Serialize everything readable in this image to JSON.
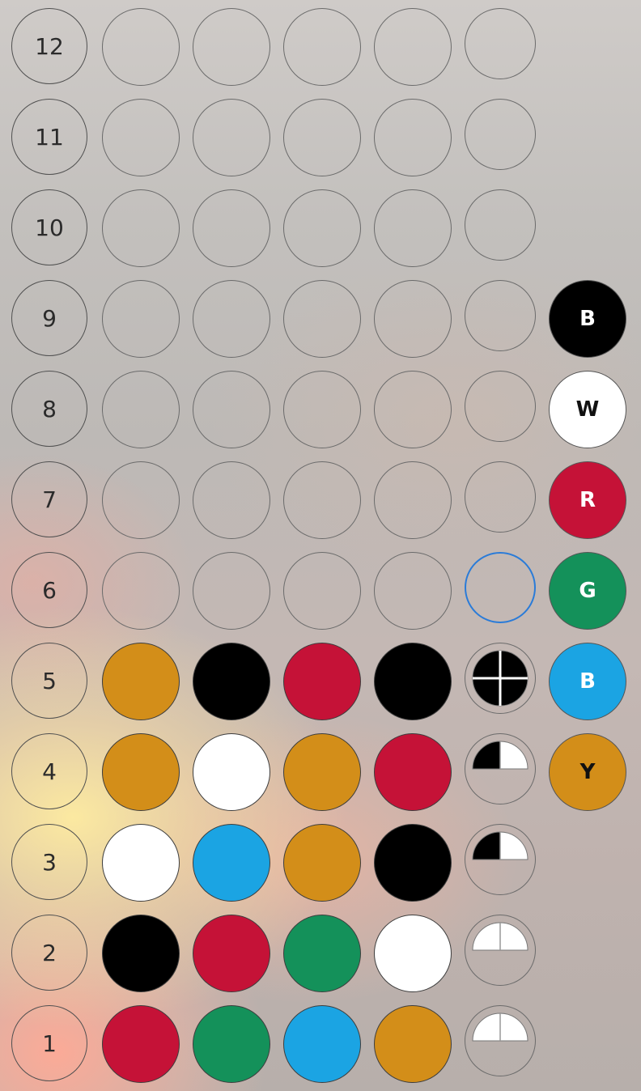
{
  "colors": {
    "orange": "#d38e19",
    "black": "#000000",
    "red": "#c51237",
    "white": "#ffffff",
    "blue": "#1ba4e3",
    "green": "#14915a"
  },
  "rows": [
    {
      "label": "12",
      "pegs": [
        null,
        null,
        null,
        null
      ],
      "feedback": null
    },
    {
      "label": "11",
      "pegs": [
        null,
        null,
        null,
        null
      ],
      "feedback": null
    },
    {
      "label": "10",
      "pegs": [
        null,
        null,
        null,
        null
      ],
      "feedback": null
    },
    {
      "label": "9",
      "pegs": [
        null,
        null,
        null,
        null
      ],
      "feedback": null
    },
    {
      "label": "8",
      "pegs": [
        null,
        null,
        null,
        null
      ],
      "feedback": null
    },
    {
      "label": "7",
      "pegs": [
        null,
        null,
        null,
        null
      ],
      "feedback": null
    },
    {
      "label": "6",
      "pegs": [
        null,
        null,
        null,
        null
      ],
      "feedback": null,
      "active": true
    },
    {
      "label": "5",
      "pegs": [
        "orange",
        "black",
        "red",
        "black"
      ],
      "feedback": [
        "black",
        "black",
        "black",
        "black"
      ]
    },
    {
      "label": "4",
      "pegs": [
        "orange",
        "white",
        "orange",
        "red"
      ],
      "feedback": [
        "black",
        "white"
      ]
    },
    {
      "label": "3",
      "pegs": [
        "white",
        "blue",
        "orange",
        "black"
      ],
      "feedback": [
        "black",
        "white"
      ]
    },
    {
      "label": "2",
      "pegs": [
        "black",
        "red",
        "green",
        "white"
      ],
      "feedback": [
        "white",
        "white"
      ]
    },
    {
      "label": "1",
      "pegs": [
        "red",
        "green",
        "blue",
        "orange"
      ],
      "feedback": [
        "white",
        "white"
      ]
    }
  ],
  "palette": [
    {
      "letter": "B",
      "color": "black",
      "text_color": "#ffffff"
    },
    {
      "letter": "W",
      "color": "white",
      "text_color": "#111111"
    },
    {
      "letter": "R",
      "color": "red",
      "text_color": "#ffffff"
    },
    {
      "letter": "G",
      "color": "green",
      "text_color": "#ffffff"
    },
    {
      "letter": "B",
      "color": "blue",
      "text_color": "#ffffff"
    },
    {
      "letter": "Y",
      "color": "orange",
      "text_color": "#111111"
    }
  ]
}
